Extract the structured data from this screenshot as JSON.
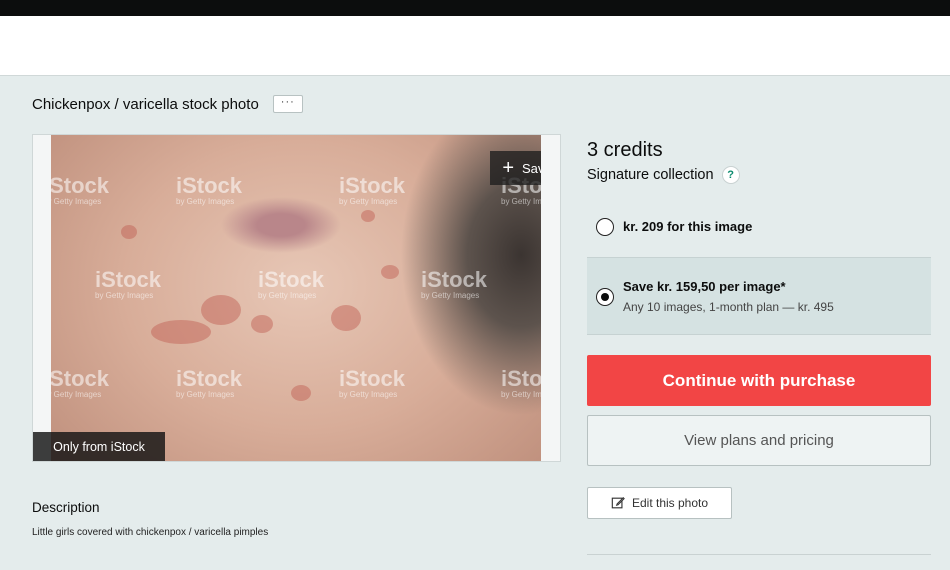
{
  "page": {
    "title": "Chickenpox / varicella stock photo",
    "more_label": "···"
  },
  "image": {
    "save_label": "Save",
    "badge": "Only from iStock",
    "watermark_brand": "iStock",
    "watermark_sub": "by Getty Images"
  },
  "description": {
    "heading": "Description",
    "text": "Little girls covered with chickenpox / varicella pimples"
  },
  "pricing": {
    "credits": "3 credits",
    "collection": "Signature collection",
    "help_symbol": "?",
    "option1_label": "kr. 209 for this image",
    "option2_label": "Save kr. 159,50 per image*",
    "option2_sub": "Any 10 images, 1-month plan — kr. 495",
    "selected_option": 2
  },
  "actions": {
    "purchase_label": "Continue with purchase",
    "plans_label": "View plans and pricing",
    "edit_label": "Edit this photo"
  },
  "colors": {
    "accent_red": "#f24545",
    "page_bg": "#e4ecec",
    "selected_option_bg": "#d5e2e2",
    "top_bar": "#0c0d0d"
  }
}
